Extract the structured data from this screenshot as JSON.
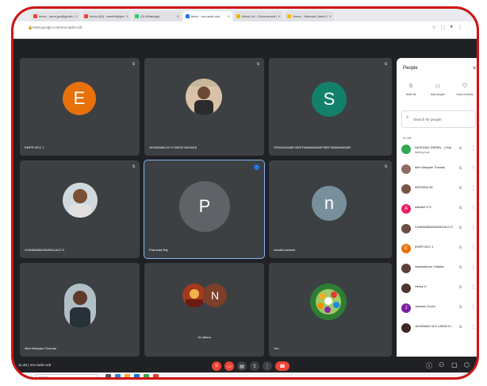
{
  "browser": {
    "tabs": [
      {
        "label": "Inbox - skmr.jpc@gmail.com",
        "color": "#ea4335",
        "active": false
      },
      {
        "label": "Inbox (63) - keerthi@gmail.com",
        "color": "#ea4335",
        "active": false
      },
      {
        "label": "(3) WhatsApp",
        "color": "#25d366",
        "active": false
      },
      {
        "label": "Meet - nnv-iackt-ocb",
        "color": "#1a73e8",
        "active": true
      },
      {
        "label": "About Us - Government Arts College",
        "color": "#f4b400",
        "active": false
      },
      {
        "label": "Home - National Cadet Corps",
        "color": "#fbbc04",
        "active": false
      }
    ],
    "url": "meet.google.com/nnv-iackt-ocb"
  },
  "tiles": [
    {
      "name": "EMPR NCC 1",
      "initial": "E",
      "color": "#e8710a"
    },
    {
      "name": "JAYARAMU M H VINOD NAYAKA",
      "initial": "",
      "color": ""
    },
    {
      "name": "SHIVAKUMAR BEETANNANAVAR BEETANNANAVAR",
      "initial": "S",
      "color": "#12806a"
    },
    {
      "name": "CHANNABASAVARAJA D S",
      "initial": "",
      "color": ""
    },
    {
      "name": "Pramoda Raj",
      "initial": "P",
      "color": "#5f6368"
    },
    {
      "name": "nandini ramesh",
      "initial": "n",
      "color": "#78909c"
    },
    {
      "name": "Alen Mariyam Thomas",
      "initial": "",
      "color": ""
    },
    {
      "name": "16 others",
      "initial": "N",
      "color": "#7b3f2a"
    },
    {
      "name": "You",
      "initial": "",
      "color": ""
    }
  ],
  "people_panel": {
    "title": "People",
    "actions": [
      {
        "label": "Mute all",
        "icon": "mic-off-icon"
      },
      {
        "label": "Add people",
        "icon": "add-person-icon"
      },
      {
        "label": "Host controls",
        "icon": "shield-icon"
      }
    ],
    "search_placeholder": "Search for people",
    "section_label": "In call",
    "participants": [
      {
        "name": "NATIONAL GREEN... (You)",
        "sub": "Meeting host",
        "initial": "",
        "color": "#34a853"
      },
      {
        "name": "Alen Mariyam Thomas",
        "sub": "",
        "initial": "",
        "color": "#8d6e63"
      },
      {
        "name": "AROOBIA Sir",
        "sub": "",
        "initial": "",
        "color": "#795548"
      },
      {
        "name": "Ashwini H G",
        "sub": "",
        "initial": "A",
        "color": "#e91e63"
      },
      {
        "name": "CHANNABASAVARAJA D S",
        "sub": "",
        "initial": "",
        "color": "#6d4c41"
      },
      {
        "name": "EMPR NCC 1",
        "sub": "",
        "initial": "E",
        "color": "#e8710a"
      },
      {
        "name": "Harshadhree Chakiku",
        "sub": "",
        "initial": "",
        "color": "#5d4037"
      },
      {
        "name": "Hema. K",
        "sub": "",
        "initial": "",
        "color": "#4e342e"
      },
      {
        "name": "Jaishree Gudur",
        "sub": "",
        "initial": "J",
        "color": "#7b1fa2"
      },
      {
        "name": "JAYARAMU M H VINOD N...",
        "sub": "",
        "initial": "",
        "color": "#3e2723"
      }
    ]
  },
  "bottom_bar": {
    "time": "11:48",
    "meeting_code": "nnv-iackt-ocb"
  },
  "taskbar": {
    "search": "Search"
  }
}
